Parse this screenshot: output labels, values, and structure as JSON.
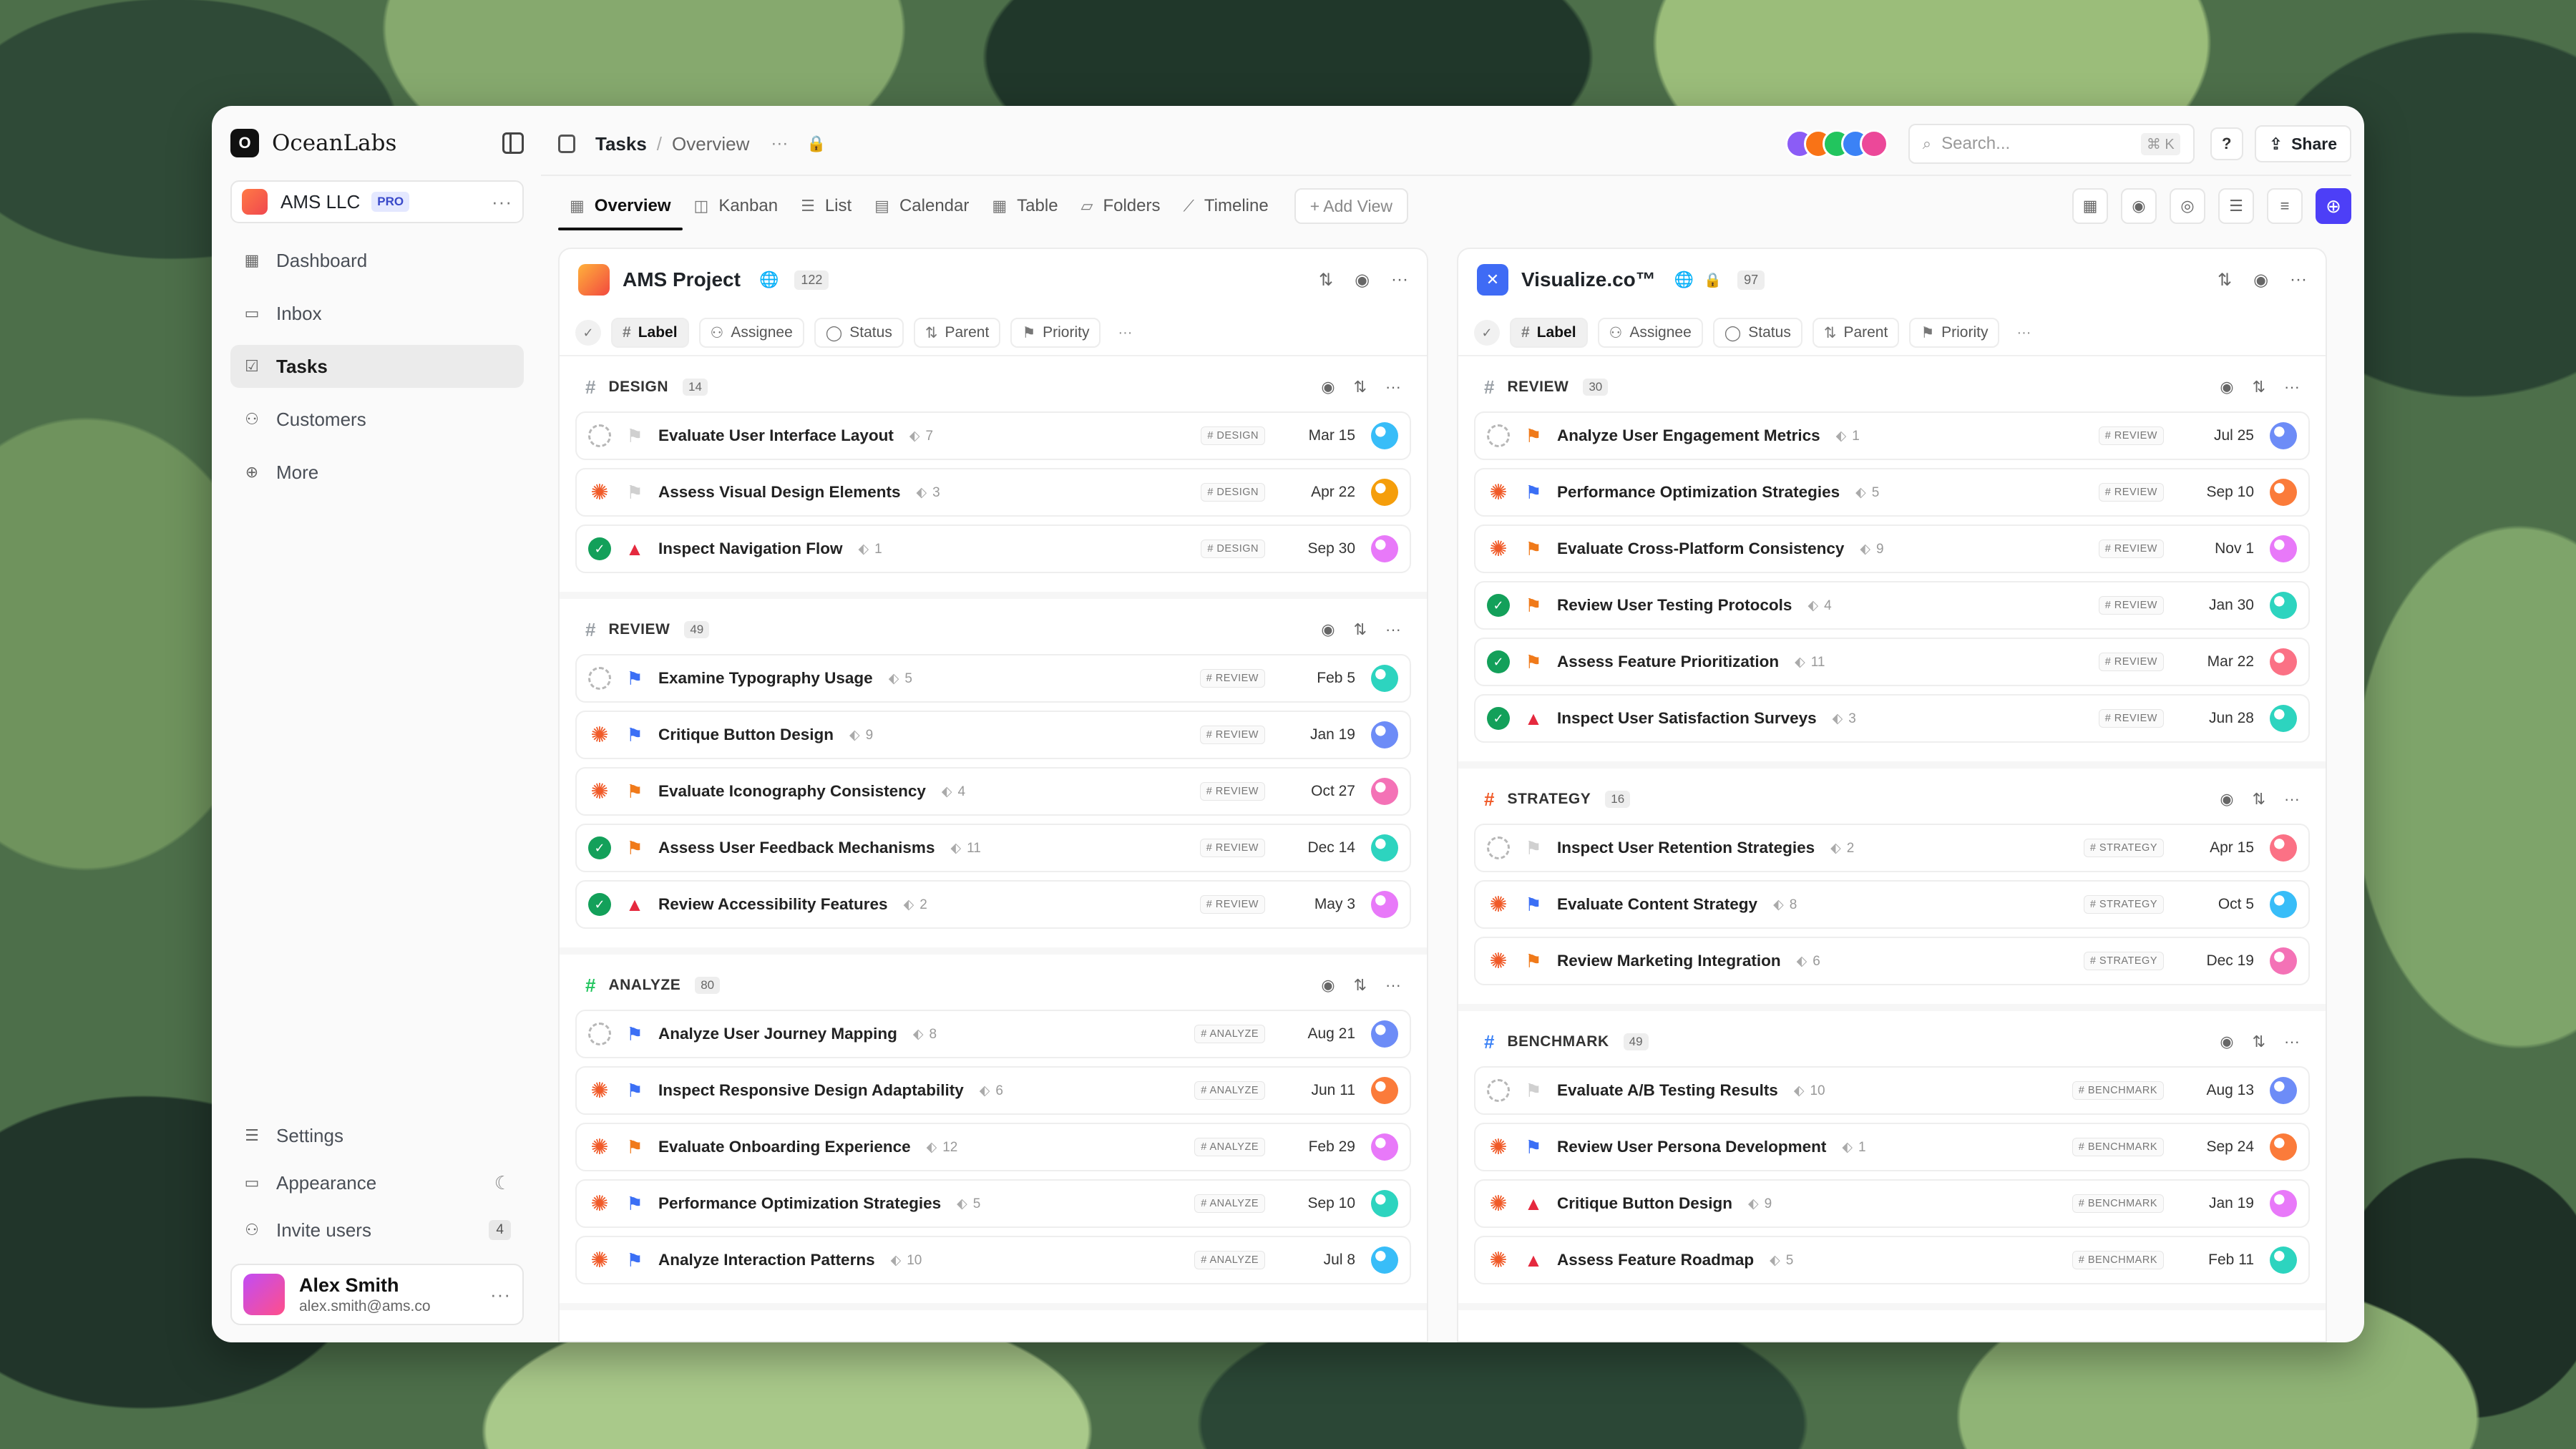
{
  "sidebar": {
    "brand": "OceanLabs",
    "logo_letter": "O",
    "workspace": {
      "name": "AMS LLC",
      "badge": "PRO"
    },
    "nav": [
      {
        "label": "Dashboard",
        "icon": "dashboard-icon"
      },
      {
        "label": "Inbox",
        "icon": "inbox-icon"
      },
      {
        "label": "Tasks",
        "icon": "tasks-icon",
        "active": true
      },
      {
        "label": "Customers",
        "icon": "customers-icon"
      },
      {
        "label": "More",
        "icon": "more-icon"
      }
    ],
    "bottom": {
      "settings": "Settings",
      "appearance": "Appearance",
      "invite": "Invite users",
      "invite_count": "4"
    },
    "user": {
      "name": "Alex Smith",
      "email": "alex.smith@ams.co"
    }
  },
  "topbar": {
    "crumb1": "Tasks",
    "crumb2": "Overview",
    "search_placeholder": "Search...",
    "shortcut": "⌘ K",
    "help": "?",
    "share": "Share",
    "avatar_colors": [
      "#8b5cf6",
      "#f97316",
      "#22c55e",
      "#3b82f6",
      "#ec4899"
    ]
  },
  "tabs": [
    {
      "label": "Overview",
      "icon": "grid-icon",
      "active": true
    },
    {
      "label": "Kanban",
      "icon": "kanban-icon"
    },
    {
      "label": "List",
      "icon": "list-icon"
    },
    {
      "label": "Calendar",
      "icon": "calendar-icon"
    },
    {
      "label": "Table",
      "icon": "table-icon"
    },
    {
      "label": "Folders",
      "icon": "folder-icon"
    },
    {
      "label": "Timeline",
      "icon": "timeline-icon"
    }
  ],
  "add_view": "+ Add View",
  "filters": [
    "Label",
    "Assignee",
    "Status",
    "Parent",
    "Priority"
  ],
  "boards": [
    {
      "title": "AMS Project",
      "count": "122",
      "groups": [
        {
          "name": "DESIGN",
          "count": "14",
          "color": "#9aa0a6",
          "tasks": [
            {
              "name": "Evaluate User Interface Layout",
              "sub": "7",
              "tag": "# DESIGN",
              "date": "Mar 15",
              "status": "todo",
              "priority": "none",
              "avatar": "#38bdf8"
            },
            {
              "name": "Assess Visual Design Elements",
              "sub": "3",
              "tag": "# DESIGN",
              "date": "Apr 22",
              "status": "progress",
              "priority": "none",
              "avatar": "#f59e0b"
            },
            {
              "name": "Inspect Navigation Flow",
              "sub": "1",
              "tag": "# DESIGN",
              "date": "Sep 30",
              "status": "done",
              "priority": "urgent",
              "avatar": "#e879f9"
            }
          ]
        },
        {
          "name": "REVIEW",
          "count": "49",
          "color": "#9aa0a6",
          "tasks": [
            {
              "name": "Examine Typography Usage",
              "sub": "5",
              "tag": "# REVIEW",
              "date": "Feb 5",
              "status": "todo",
              "priority": "blue",
              "avatar": "#2dd4bf"
            },
            {
              "name": "Critique Button Design",
              "sub": "9",
              "tag": "# REVIEW",
              "date": "Jan 19",
              "status": "progress",
              "priority": "blue",
              "avatar": "#6d8cf7"
            },
            {
              "name": "Evaluate Iconography Consistency",
              "sub": "4",
              "tag": "# REVIEW",
              "date": "Oct 27",
              "status": "progress",
              "priority": "orange",
              "avatar": "#f472b6"
            },
            {
              "name": "Assess User Feedback Mechanisms",
              "sub": "11",
              "tag": "# REVIEW",
              "date": "Dec 14",
              "status": "done",
              "priority": "orange",
              "avatar": "#2dd4bf"
            },
            {
              "name": "Review Accessibility Features",
              "sub": "2",
              "tag": "# REVIEW",
              "date": "May 3",
              "status": "done",
              "priority": "urgent",
              "avatar": "#e879f9"
            }
          ]
        },
        {
          "name": "ANALYZE",
          "count": "80",
          "color": "#22c55e",
          "tasks": [
            {
              "name": "Analyze User Journey Mapping",
              "sub": "8",
              "tag": "# ANALYZE",
              "date": "Aug 21",
              "status": "todo",
              "priority": "blue",
              "avatar": "#6d8cf7"
            },
            {
              "name": "Inspect Responsive Design Adaptability",
              "sub": "6",
              "tag": "# ANALYZE",
              "date": "Jun 11",
              "status": "progress",
              "priority": "blue",
              "avatar": "#fb7b3a"
            },
            {
              "name": "Evaluate Onboarding Experience",
              "sub": "12",
              "tag": "# ANALYZE",
              "date": "Feb 29",
              "status": "progress",
              "priority": "orange",
              "avatar": "#e879f9"
            },
            {
              "name": "Performance Optimization Strategies",
              "sub": "5",
              "tag": "# ANALYZE",
              "date": "Sep 10",
              "status": "progress",
              "priority": "blue",
              "avatar": "#2dd4bf"
            },
            {
              "name": "Analyze Interaction Patterns",
              "sub": "10",
              "tag": "# ANALYZE",
              "date": "Jul 8",
              "status": "progress",
              "priority": "blue",
              "avatar": "#38bdf8"
            }
          ]
        }
      ]
    },
    {
      "title": "Visualize.co™",
      "count": "97",
      "groups": [
        {
          "name": "REVIEW",
          "count": "30",
          "color": "#9aa0a6",
          "tasks": [
            {
              "name": "Analyze User Engagement Metrics",
              "sub": "1",
              "tag": "# REVIEW",
              "date": "Jul 25",
              "status": "todo",
              "priority": "orange",
              "avatar": "#6d8cf7"
            },
            {
              "name": "Performance Optimization Strategies",
              "sub": "5",
              "tag": "# REVIEW",
              "date": "Sep 10",
              "status": "progress",
              "priority": "blue",
              "avatar": "#fb7b3a"
            },
            {
              "name": "Evaluate Cross-Platform Consistency",
              "sub": "9",
              "tag": "# REVIEW",
              "date": "Nov 1",
              "status": "progress",
              "priority": "orange",
              "avatar": "#e879f9"
            },
            {
              "name": "Review User Testing Protocols",
              "sub": "4",
              "tag": "# REVIEW",
              "date": "Jan 30",
              "status": "done",
              "priority": "orange",
              "avatar": "#2dd4bf"
            },
            {
              "name": "Assess Feature Prioritization",
              "sub": "11",
              "tag": "# REVIEW",
              "date": "Mar 22",
              "status": "done",
              "priority": "orange",
              "avatar": "#fb7185"
            },
            {
              "name": "Inspect User Satisfaction Surveys",
              "sub": "3",
              "tag": "# REVIEW",
              "date": "Jun 28",
              "status": "done",
              "priority": "urgent",
              "avatar": "#2dd4bf"
            }
          ]
        },
        {
          "name": "STRATEGY",
          "count": "16",
          "color": "#f05a28",
          "tasks": [
            {
              "name": "Inspect User Retention Strategies",
              "sub": "2",
              "tag": "# STRATEGY",
              "date": "Apr 15",
              "status": "todo",
              "priority": "none",
              "avatar": "#fb7185"
            },
            {
              "name": "Evaluate Content Strategy",
              "sub": "8",
              "tag": "# STRATEGY",
              "date": "Oct 5",
              "status": "progress",
              "priority": "blue",
              "avatar": "#38bdf8"
            },
            {
              "name": "Review Marketing Integration",
              "sub": "6",
              "tag": "# STRATEGY",
              "date": "Dec 19",
              "status": "progress",
              "priority": "orange",
              "avatar": "#f472b6"
            }
          ]
        },
        {
          "name": "BENCHMARK",
          "count": "49",
          "color": "#3b82f6",
          "tasks": [
            {
              "name": "Evaluate A/B Testing Results",
              "sub": "10",
              "tag": "# BENCHMARK",
              "date": "Aug 13",
              "status": "todo",
              "priority": "none",
              "avatar": "#6d8cf7"
            },
            {
              "name": "Review User Persona Development",
              "sub": "1",
              "tag": "# BENCHMARK",
              "date": "Sep 24",
              "status": "progress",
              "priority": "blue",
              "avatar": "#fb7b3a"
            },
            {
              "name": "Critique Button Design",
              "sub": "9",
              "tag": "# BENCHMARK",
              "date": "Jan 19",
              "status": "progress",
              "priority": "urgent",
              "avatar": "#e879f9"
            },
            {
              "name": "Assess Feature Roadmap",
              "sub": "5",
              "tag": "# BENCHMARK",
              "date": "Feb 11",
              "status": "progress",
              "priority": "urgent",
              "avatar": "#2dd4bf"
            }
          ]
        }
      ]
    }
  ]
}
